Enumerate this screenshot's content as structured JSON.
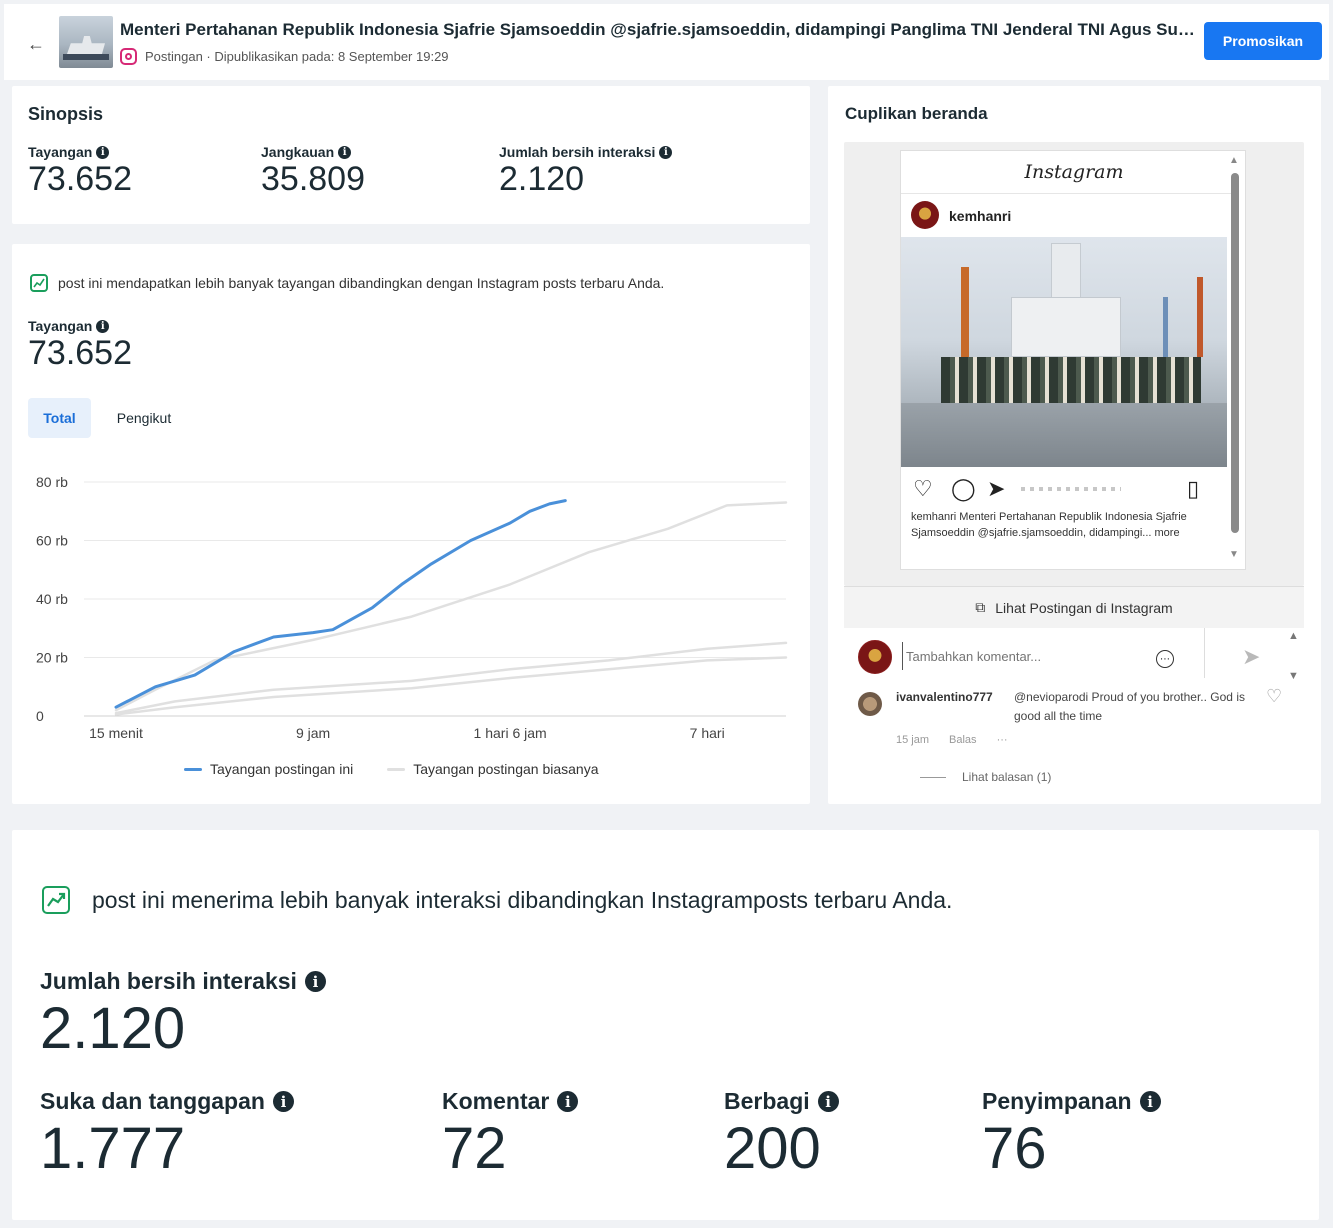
{
  "header": {
    "title": "Menteri Pertahanan Republik Indonesia Sjafrie Sjamsoeddin @sjafrie.sjamsoeddin, didampingi Panglima TNI Jenderal TNI Agus Sub...",
    "subtitle": "Postingan · Dipublikasikan pada: 8 September 19:29",
    "promote_label": "Promosikan",
    "back_icon": "arrow-left-icon"
  },
  "sinopsis": {
    "title": "Sinopsis",
    "metrics": [
      {
        "label": "Tayangan",
        "value": "73.652"
      },
      {
        "label": "Jangkauan",
        "value": "35.809"
      },
      {
        "label": "Jumlah bersih interaksi",
        "value": "2.120"
      }
    ]
  },
  "views_card": {
    "note": "post ini mendapatkan lebih banyak tayangan dibandingkan dengan Instagram posts terbaru Anda.",
    "metric_label": "Tayangan",
    "metric_value": "73.652",
    "tabs": [
      "Total",
      "Pengikut"
    ],
    "active_tab": "Total"
  },
  "chart_data": {
    "type": "line",
    "y_tick_labels": [
      "80 rb",
      "60 rb",
      "40 rb",
      "20 rb",
      "0"
    ],
    "y_ticks": [
      80000,
      60000,
      40000,
      20000,
      0
    ],
    "ylim": [
      0,
      80000
    ],
    "x_tick_labels": [
      "15 menit",
      "9 jam",
      "1 hari 6 jam",
      "7 hari"
    ],
    "x_tick_positions": [
      0,
      1,
      2,
      3
    ],
    "xlim": [
      0,
      3.4
    ],
    "grid": true,
    "legend": "bottom",
    "series": [
      {
        "name": "Tayangan postingan ini",
        "color": "#4a90d9",
        "x": [
          0,
          0.2,
          0.4,
          0.6,
          0.8,
          1.0,
          1.1,
          1.3,
          1.45,
          1.6,
          1.8,
          2.0,
          2.1,
          2.2,
          2.28
        ],
        "y": [
          3000,
          10000,
          14000,
          22000,
          27000,
          28500,
          29500,
          37000,
          45000,
          52000,
          60000,
          66000,
          70000,
          72500,
          73652
        ]
      },
      {
        "name": "Tayangan postingan biasanya",
        "color": "#e0e0e0",
        "x": [
          0,
          0.2,
          0.5,
          1.0,
          1.5,
          2.0,
          2.4,
          2.8,
          3.1,
          3.4
        ],
        "y": [
          2000,
          9000,
          19000,
          26000,
          34000,
          45000,
          56000,
          64000,
          72000,
          73000
        ]
      },
      {
        "name": "",
        "color": "#e0e0e0",
        "x": [
          0,
          0.3,
          0.8,
          1.5,
          2.0,
          2.5,
          3.0,
          3.4
        ],
        "y": [
          1000,
          5000,
          9000,
          12000,
          16000,
          19000,
          23000,
          25000
        ]
      },
      {
        "name": "",
        "color": "#e0e0e0",
        "x": [
          0,
          0.3,
          0.8,
          1.5,
          2.0,
          2.5,
          3.0,
          3.4
        ],
        "y": [
          500,
          3000,
          6500,
          9500,
          13000,
          16000,
          19000,
          20000
        ]
      }
    ]
  },
  "preview": {
    "title": "Cuplikan beranda",
    "ig_logo": "Instagram",
    "username": "kemhanri",
    "caption": "kemhanri Menteri Pertahanan Republik Indonesia Sjafrie Sjamsoeddin @sjafrie.sjamsoeddin, didampingi... more",
    "view_on_ig": "Lihat Postingan di Instagram",
    "comment_placeholder": "Tambahkan komentar...",
    "comment": {
      "user": "ivanvalentino777",
      "text": "@nevioparodi Proud of you brother.. God is good all the time",
      "time": "15 jam",
      "reply": "Balas",
      "more": "···",
      "view_replies": "Lihat balasan (1)"
    }
  },
  "interactions": {
    "note": "post ini menerima lebih banyak interaksi dibandingkan Instagramposts terbaru Anda.",
    "total_label": "Jumlah bersih interaksi",
    "total_value": "2.120",
    "breakdown": [
      {
        "label": "Suka dan tanggapan",
        "value": "1.777"
      },
      {
        "label": "Komentar",
        "value": "72"
      },
      {
        "label": "Berbagi",
        "value": "200"
      },
      {
        "label": "Penyimpanan",
        "value": "76"
      }
    ]
  }
}
